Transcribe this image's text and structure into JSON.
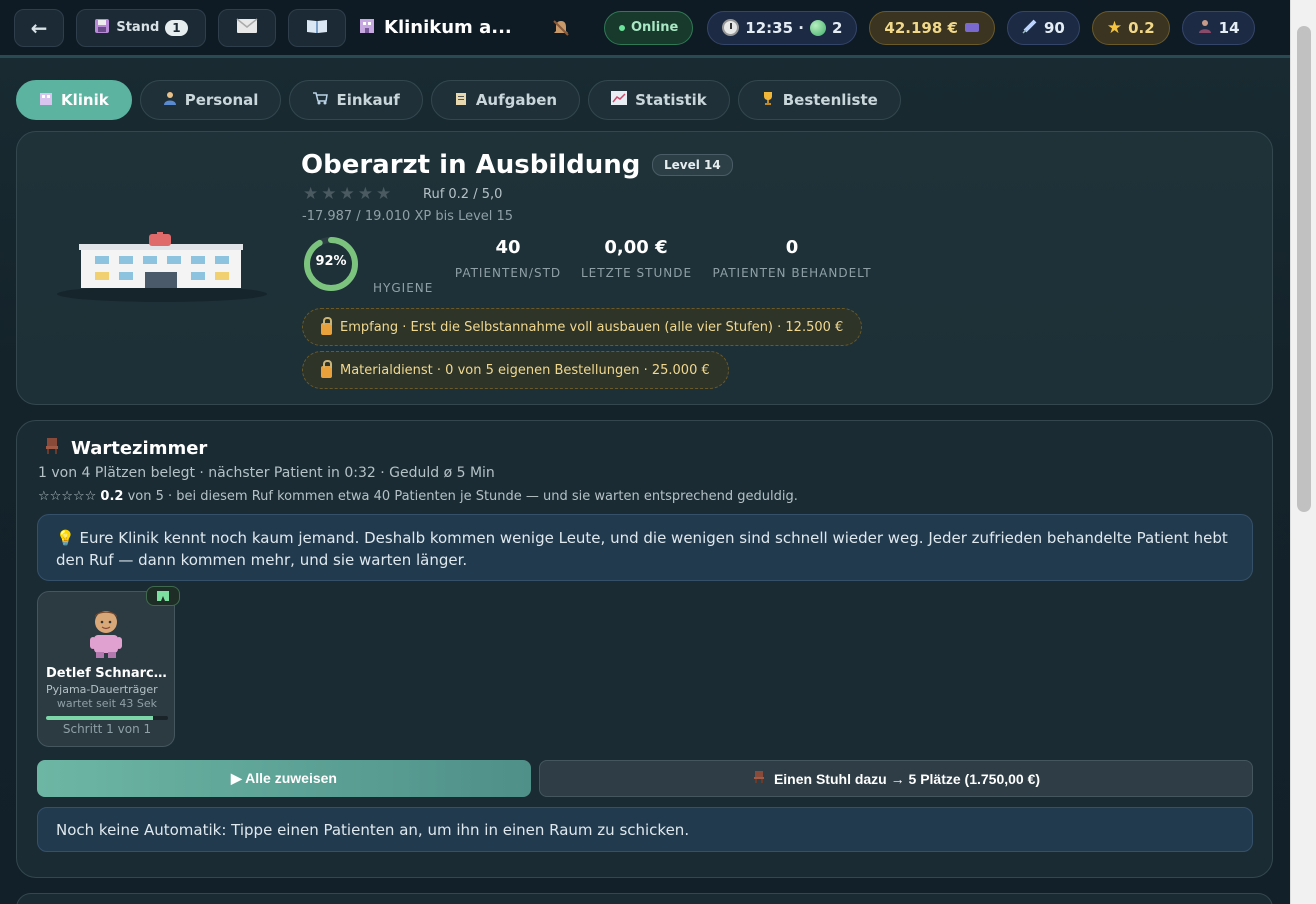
{
  "topbar": {
    "back_icon": "←",
    "save_label": "Stand",
    "save_count": "1",
    "title": "Klinikum a...",
    "status": "Online",
    "time": "12:35 ·",
    "gems": "2",
    "money": "42.198 €",
    "syringes": "90",
    "rating": "0.2",
    "staff": "14"
  },
  "tabs": [
    {
      "label": "Klinik",
      "icon": "hospital-icon",
      "active": true
    },
    {
      "label": "Personal",
      "icon": "person-icon"
    },
    {
      "label": "Einkauf",
      "icon": "cart-icon"
    },
    {
      "label": "Aufgaben",
      "icon": "clipboard-icon"
    },
    {
      "label": "Statistik",
      "icon": "chart-icon"
    },
    {
      "label": "Bestenliste",
      "icon": "trophy-icon"
    }
  ],
  "clinic": {
    "rank": "Oberarzt in Ausbildung",
    "level_badge": "Level 14",
    "stars": "★★★★★",
    "reputation": "Ruf 0.2 / 5,0",
    "xp": "-17.987 / 19.010 XP bis Level 15",
    "hygiene_percent": 92,
    "hygiene_text": "92%",
    "hygiene_label": "HYGIENE",
    "stats": [
      {
        "value": "40",
        "label": "PATIENTEN/STD"
      },
      {
        "value": "0,00 €",
        "label": "LETZTE STUNDE"
      },
      {
        "value": "0",
        "label": "PATIENTEN BEHANDELT"
      }
    ],
    "locks": [
      "Empfang · Erst die Selbstannahme voll ausbauen (alle vier Stufen) · 12.500 €",
      "Materialdienst · 0 von 5 eigenen Bestellungen · 25.000 €"
    ]
  },
  "waiting_room": {
    "title": "Wartezimmer",
    "subtitle": "1 von 4 Plätzen belegt · nächster Patient in 0:32 · Geduld ø 5 Min",
    "rating_stars": "☆☆☆☆☆",
    "rating_value": "0.2",
    "rating_text": "von 5 · bei diesem Ruf kommen etwa 40 Patienten je Stunde — und sie warten entsprechend geduldig.",
    "tip": "Eure Klinik kennt noch kaum jemand. Deshalb kommen wenige Leute, und die wenigen sind schnell wieder weg. Jeder zufrieden behandelte Patient hebt den Ruf — dann kommen mehr, und sie warten länger.",
    "patient": {
      "name": "Detlef Schnarchbeck",
      "desc": "Pyjama-Dauerträger",
      "waiting": "wartet seit 43 Sek",
      "progress": 0.88,
      "step": "Schritt 1 von 1"
    },
    "assign_label": "▶ Alle zuweisen",
    "chair_label": "Einen Stuhl dazu → 5 Plätze (1.750,00 €)",
    "info": "Noch keine Automatik: Tippe einen Patienten an, um ihn in einen Raum zu schicken."
  }
}
